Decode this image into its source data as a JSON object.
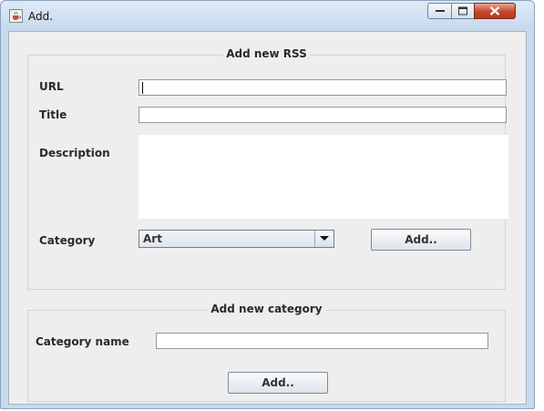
{
  "window": {
    "title": "Add.",
    "icons": {
      "app": "java-cup-icon",
      "minimize": "minimize-icon",
      "maximize": "maximize-icon",
      "close": "close-icon"
    }
  },
  "rss_group": {
    "legend": "Add new RSS",
    "url_label": "URL",
    "url_value": "",
    "title_label": "Title",
    "title_value": "",
    "description_label": "Description",
    "description_value": "",
    "category_label": "Category",
    "category_selected": "Art",
    "add_button": "Add.."
  },
  "category_group": {
    "legend": "Add new category",
    "name_label": "Category name",
    "name_value": "",
    "add_button": "Add.."
  }
}
